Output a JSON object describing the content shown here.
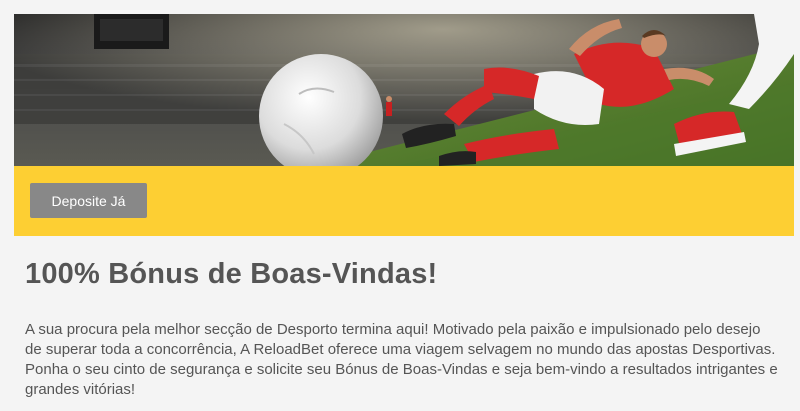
{
  "hero": {
    "image": "football-player-sliding-tackle-stadium",
    "colors": {
      "jersey": "#d62828",
      "grass": "#4f7a2c",
      "crowd": "#3a3a3a"
    }
  },
  "cta": {
    "background": "#fdcf33",
    "button_label": "Deposite Já",
    "button_color": "#888888"
  },
  "main": {
    "title": "100% Bónus de Boas-Vindas!",
    "description": "A sua procura pela melhor secção de Desporto termina aqui! Motivado pela paixão e impulsionado pelo desejo de superar toda a concorrência, A ReloadBet oferece uma viagem selvagem no mundo das apostas Desportivas. Ponha o seu cinto de segurança e solicite seu Bónus de Boas-Vindas e seja bem-vindo a resultados intrigantes e grandes vitórias!"
  }
}
